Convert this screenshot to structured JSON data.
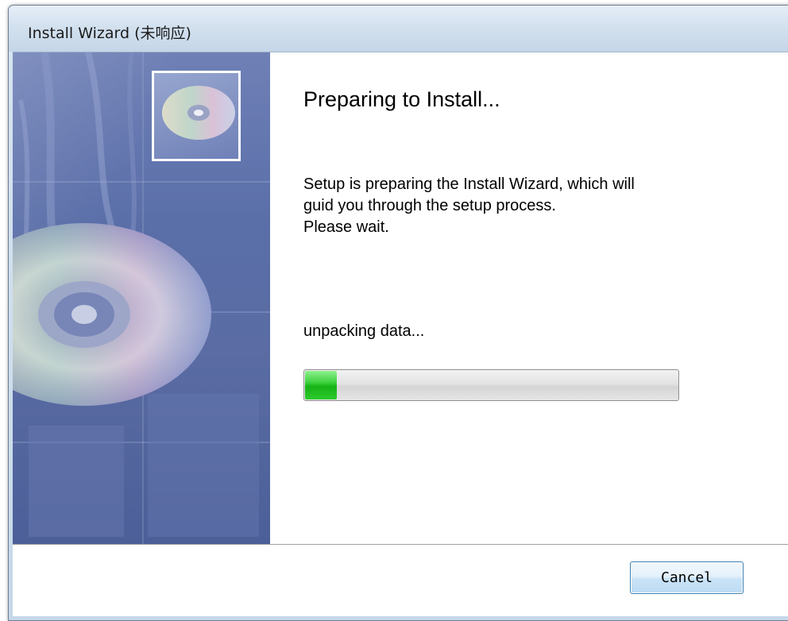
{
  "window": {
    "title": "Install Wizard (未响应)"
  },
  "side_panel": {
    "image": "cd-disc-artwork",
    "icon": "cd-disc-icon"
  },
  "content": {
    "heading": "Preparing to Install...",
    "description_lines": [
      "Setup is preparing the Install Wizard, which will",
      "guid you through the setup process.",
      "Please wait."
    ],
    "status": "unpacking data...",
    "progress_fraction": 0.09,
    "progress_color": "#1db51d"
  },
  "footer": {
    "cancel_label": "Cancel"
  }
}
